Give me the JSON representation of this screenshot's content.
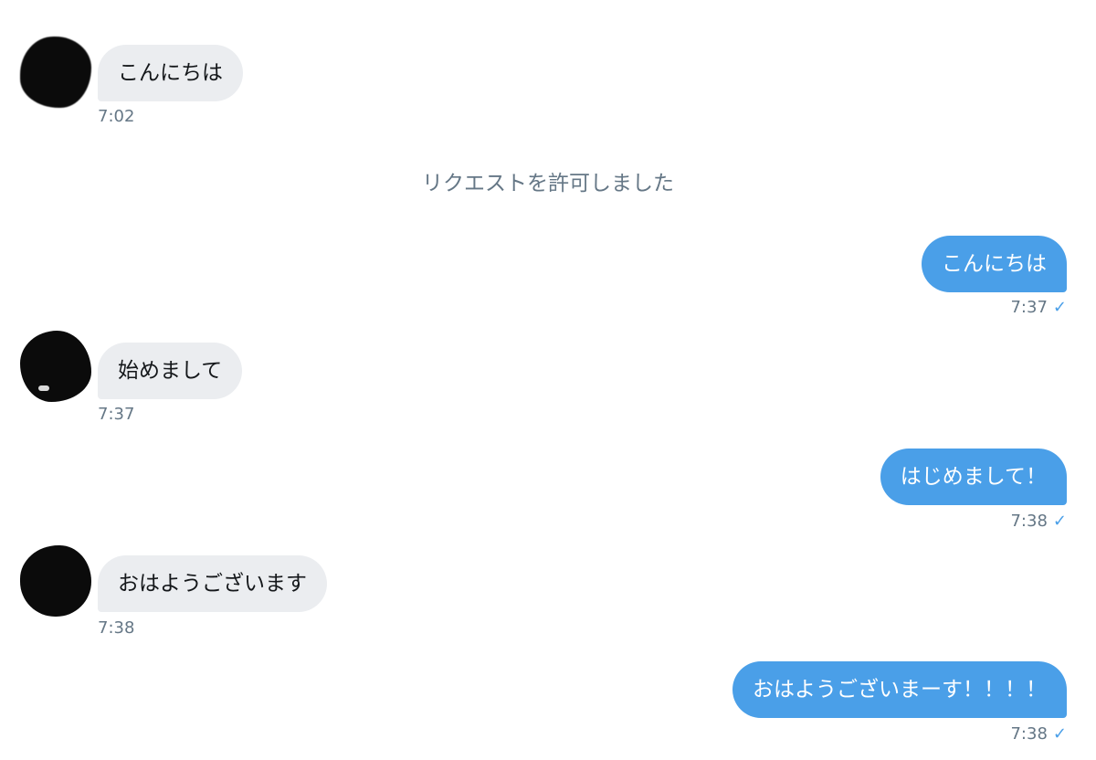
{
  "system_notice": "リクエストを許可しました",
  "messages": [
    {
      "direction": "in",
      "text": "こんにちは",
      "time": "7:02"
    },
    {
      "direction": "out",
      "text": "こんにちは",
      "time": "7:37",
      "status_icon": "check-icon"
    },
    {
      "direction": "in",
      "text": "始めまして",
      "time": "7:37"
    },
    {
      "direction": "out",
      "text": "はじめまして！",
      "time": "7:38",
      "status_icon": "check-icon"
    },
    {
      "direction": "in",
      "text": "おはようございます",
      "time": "7:38"
    },
    {
      "direction": "out",
      "text": "おはようございまーす！！！！",
      "time": "7:38",
      "status_icon": "check-icon"
    }
  ],
  "check_glyph": "✓",
  "colors": {
    "incoming_bubble": "#ebedf0",
    "outgoing_bubble": "#4a9fe8",
    "timestamp": "#657786",
    "avatar_redaction": "#0b0b0b"
  }
}
